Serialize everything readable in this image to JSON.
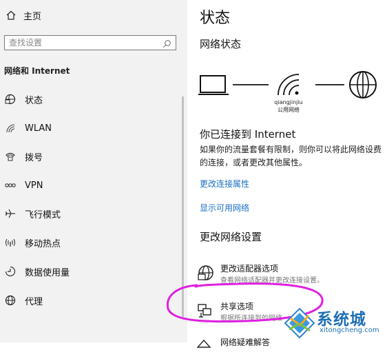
{
  "sidebar": {
    "home_label": "主页",
    "search_placeholder": "查找设置",
    "section_title": "网络和 Internet",
    "items": [
      {
        "label": "状态",
        "icon": "status-icon"
      },
      {
        "label": "WLAN",
        "icon": "wifi-icon"
      },
      {
        "label": "拨号",
        "icon": "dialup-icon"
      },
      {
        "label": "VPN",
        "icon": "vpn-icon"
      },
      {
        "label": "飞行模式",
        "icon": "airplane-icon"
      },
      {
        "label": "移动热点",
        "icon": "hotspot-icon"
      },
      {
        "label": "数据使用量",
        "icon": "data-usage-icon"
      },
      {
        "label": "代理",
        "icon": "proxy-icon"
      }
    ]
  },
  "main": {
    "title": "状态",
    "network_status_title": "网络状态",
    "network_name": "qiangjinjiu",
    "network_type": "公用网络",
    "connected_text": "你已连接到 Internet",
    "description": "如果你的流量套餐有限制，则你可以将此网络设费的连接，或者更改其他属性。",
    "links": [
      "更改连接属性",
      "显示可用网络"
    ],
    "change_settings_title": "更改网络设置",
    "options": [
      {
        "title": "更改适配器选项",
        "desc": "查看网络适配器并更改连接设置。"
      },
      {
        "title": "共享选项",
        "desc": "根据所连接到的网络"
      },
      {
        "title": "网络疑难解答",
        "desc": ""
      }
    ]
  },
  "watermark": {
    "text": "系统城",
    "url": "xitongcheng.com"
  },
  "colors": {
    "link": "#1a6fc2",
    "annotation": "#e020e0",
    "sidebar_bg": "#f2f2f2"
  }
}
